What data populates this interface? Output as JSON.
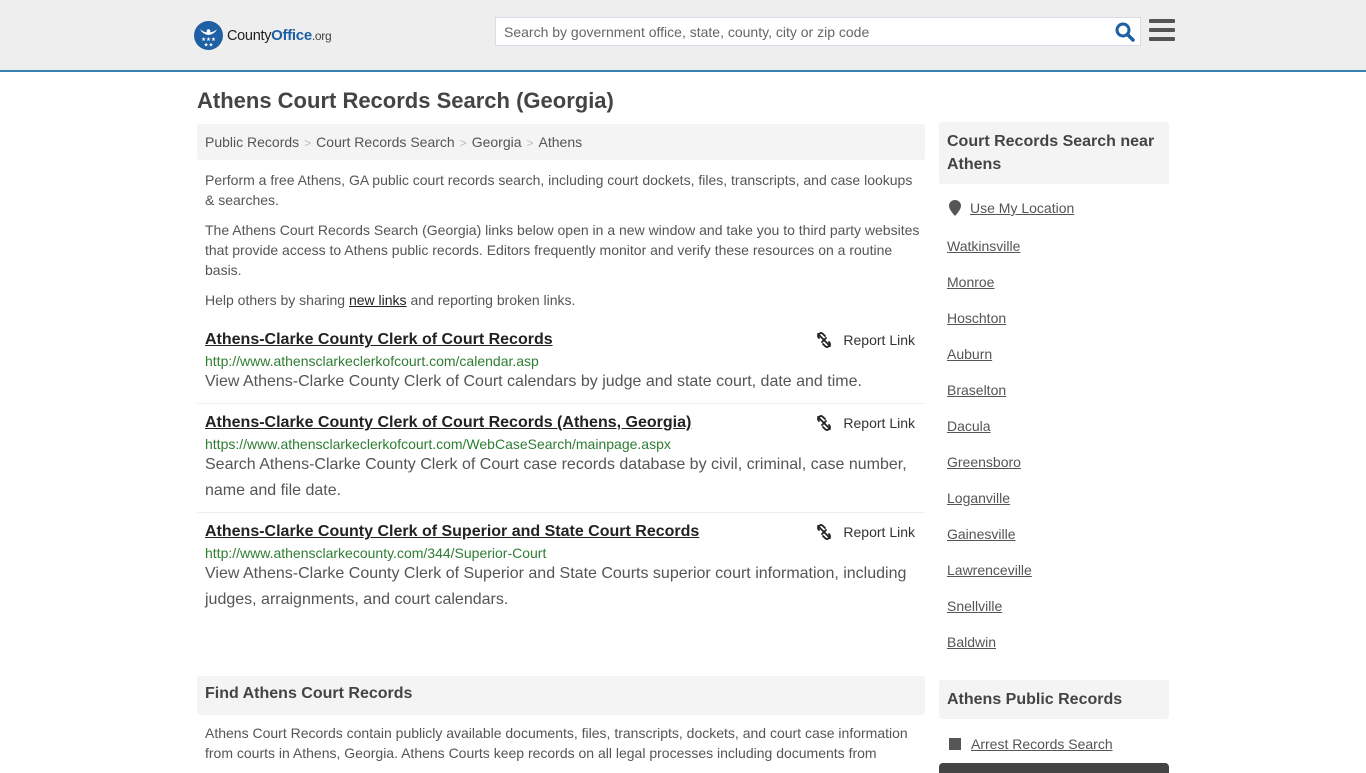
{
  "header": {
    "logo": {
      "prefix": "County",
      "brand": "Office",
      "tld": ".org"
    },
    "search": {
      "placeholder": "Search by government office, state, county, city or zip code",
      "value": ""
    },
    "icons": {
      "search": "search-icon",
      "menu": "hamburger-menu-icon"
    }
  },
  "page": {
    "title": "Athens Court Records Search (Georgia)",
    "breadcrumb": [
      "Public Records",
      "Court Records Search",
      "Georgia",
      "Athens"
    ],
    "intro": {
      "p1": "Perform a free Athens, GA public court records search, including court dockets, files, transcripts, and case lookups & searches.",
      "p2": "The Athens Court Records Search (Georgia) links below open in a new window and take you to third party websites that provide access to Athens public records. Editors frequently monitor and verify these resources on a routine basis.",
      "p3_before": "Help others by sharing ",
      "p3_link": "new links",
      "p3_after": " and reporting broken links."
    },
    "report_label": "Report Link",
    "results": [
      {
        "title": "Athens-Clarke County Clerk of Court Records",
        "url": "http://www.athensclarkeclerkofcourt.com/calendar.asp",
        "description": "View Athens-Clarke County Clerk of Court calendars by judge and state court, date and time."
      },
      {
        "title": "Athens-Clarke County Clerk of Court Records (Athens, Georgia)",
        "url": "https://www.athensclarkeclerkofcourt.com/WebCaseSearch/mainpage.aspx",
        "description": "Search Athens-Clarke County Clerk of Court case records database by civil, criminal, case number, name and file date."
      },
      {
        "title": "Athens-Clarke County Clerk of Superior and State Court Records",
        "url": "http://www.athensclarkecounty.com/344/Superior-Court",
        "description": "View Athens-Clarke County Clerk of Superior and State Courts superior court information, including judges, arraignments, and court calendars."
      }
    ],
    "find": {
      "heading": "Find Athens Court Records",
      "text": "Athens Court Records contain publicly available documents, files, transcripts, dockets, and court case information from courts in Athens, Georgia. Athens Courts keep records on all legal processes including documents from"
    }
  },
  "sidebar": {
    "nearby_heading": "Court Records Search near Athens",
    "use_location": "Use My Location",
    "nearby": [
      "Watkinsville",
      "Monroe",
      "Hoschton",
      "Auburn",
      "Braselton",
      "Dacula",
      "Greensboro",
      "Loganville",
      "Gainesville",
      "Lawrenceville",
      "Snellville",
      "Baldwin"
    ],
    "public_records_heading": "Athens Public Records",
    "public_records": [
      "Arrest Records Search"
    ]
  },
  "colors": {
    "accent": "#3a7fb4",
    "brand": "#1f5fa3",
    "url_green": "#2e7d32"
  }
}
